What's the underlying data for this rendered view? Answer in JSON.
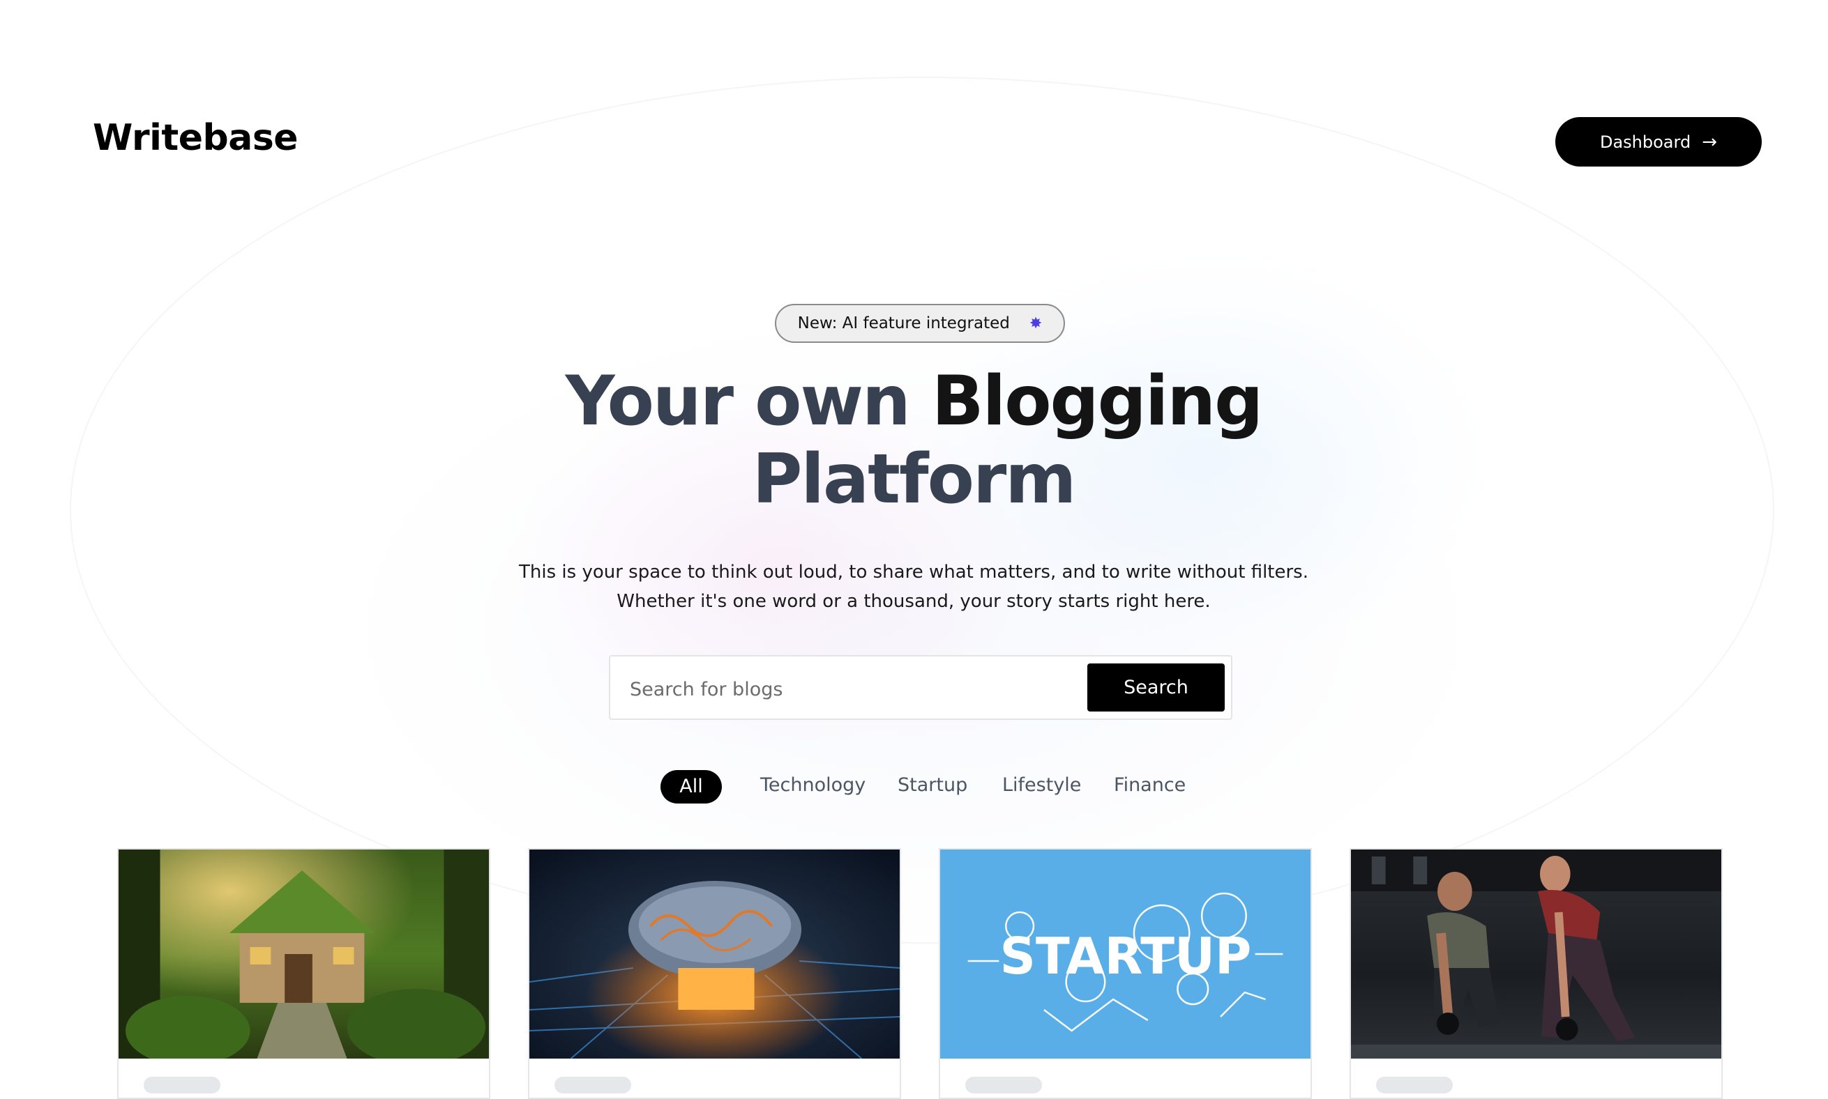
{
  "brand": {
    "name": "Writebase"
  },
  "header": {
    "dashboard_label": "Dashboard",
    "dashboard_icon": "arrow-right-icon"
  },
  "hero": {
    "badge_text": "New: AI feature integrated",
    "badge_icon": "sparkle-icon",
    "title_part1": "Your own ",
    "title_part2": "Blogging",
    "title_part3": "Platform",
    "description": "This is your space to think out loud, to share what matters, and to write without filters. Whether it's one word or a thousand, your story starts right here."
  },
  "search": {
    "placeholder": "Search for blogs",
    "value": "",
    "button_label": "Search"
  },
  "filters": {
    "items": [
      {
        "label": "All",
        "active": true
      },
      {
        "label": "Technology",
        "active": false
      },
      {
        "label": "Startup",
        "active": false
      },
      {
        "label": "Lifestyle",
        "active": false
      },
      {
        "label": "Finance",
        "active": false
      }
    ]
  },
  "cards": [
    {
      "image": "forest-cottage-image"
    },
    {
      "image": "circuit-brain-image"
    },
    {
      "image": "startup-illustration-image",
      "image_text": "STARTUP"
    },
    {
      "image": "kettlebell-workout-image"
    }
  ],
  "colors": {
    "primary": "#000000",
    "title_dark": "#141414",
    "title_muted": "#374151",
    "filter_text": "#4b5563",
    "badge_bg": "#efefef",
    "sparkle": "#4b3fe0",
    "startup_bg": "#5aaee8"
  }
}
